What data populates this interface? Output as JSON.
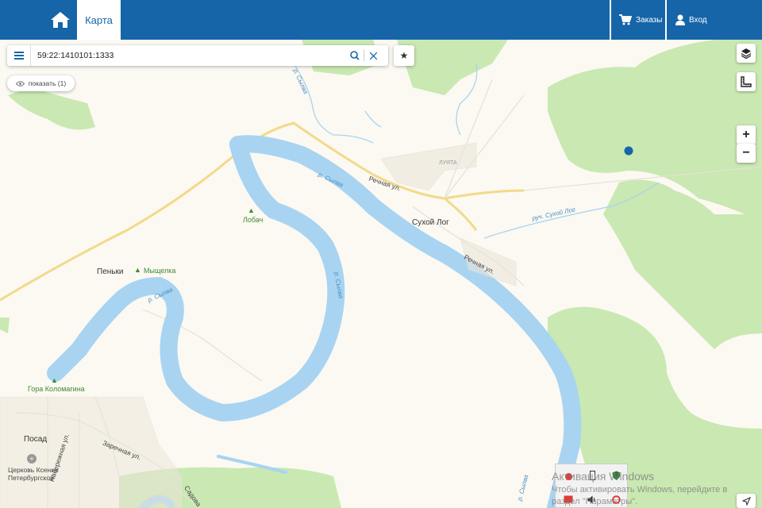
{
  "header": {
    "home_icon": "home-icon",
    "map_tab": "Карта",
    "orders_label": "Заказы",
    "login_label": "Вход"
  },
  "search": {
    "value": "59:22:1410101:1333",
    "show_label": "показать (1)"
  },
  "map_controls": {
    "zoom_in": "+",
    "zoom_out": "−"
  },
  "map_labels": {
    "sukhoy_log": "Сухой Лог",
    "lobach": "Лобач",
    "penki": "Пеньки",
    "myshchelka": "Мыщелка",
    "gora": "Гора Коломагина",
    "posad": "Посад",
    "church": "Церковь Ксении Петербургской",
    "luyata": "ЛУЯТА",
    "rechnaya1": "Речная ул.",
    "rechnaya2": "Речная ул.",
    "ruch": "руч. Сухой Лог",
    "sylva1": "р. Сылва",
    "sylva2": "р. Сылва",
    "sylva3": "р. Сылва",
    "sylva4": "р. Сылва",
    "sylva5": "р. Сылва",
    "zarechnaya": "Заречная ул.",
    "naberezhnaya": "Набережная ул.",
    "sadovaya": "Садова"
  },
  "watermark": {
    "line1": "Активация Windows",
    "line2": "Чтобы активировать Windows, перейдите в",
    "line3": "раздел \"Параметры\"."
  },
  "colors": {
    "header": "#1565a8",
    "water": "#a8d4f2",
    "forest": "#c9e8b2",
    "road": "#f7df8f",
    "land": "#fbf9f2",
    "marker": "#1565a8"
  }
}
